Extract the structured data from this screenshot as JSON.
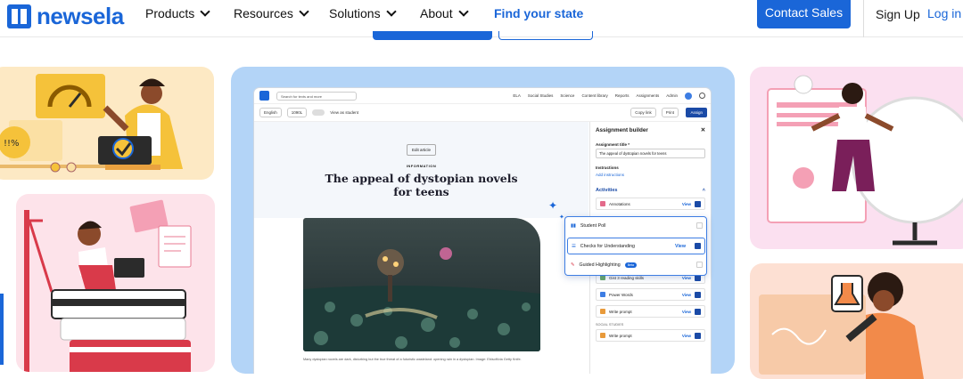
{
  "brand": {
    "name": "newsela"
  },
  "nav": {
    "items": [
      {
        "label": "Products",
        "has_menu": true
      },
      {
        "label": "Resources",
        "has_menu": true
      },
      {
        "label": "Solutions",
        "has_menu": true
      },
      {
        "label": "About",
        "has_menu": true
      }
    ],
    "find_state": "Find your state",
    "contact": "Contact Sales",
    "signup": "Sign Up",
    "login": "Log in"
  },
  "app": {
    "search_placeholder": "Search for texts and more",
    "top_links": [
      "ELA",
      "Social Studies",
      "Science",
      "Content library",
      "Reports",
      "Assignments",
      "Admin"
    ],
    "language": "English",
    "level": "1090L",
    "view_as_student": "View as student",
    "copy_link": "Copy link",
    "print": "Print",
    "assign": "Assign",
    "edit_article": "Edit article",
    "kicker": "INFORMATION",
    "article_title": "The appeal of dystopian novels for teens",
    "caption": "Many dystopian novels are dark, disturbing but the true threat of a futuristic wasteland: opening rain in a dystopian. Image: Ebisoft/via Getty Knife.",
    "builder": {
      "title": "Assignment builder",
      "title_label": "Assignment title *",
      "title_value": "The appeal of dystopian novels for teens",
      "instructions_label": "Instructions",
      "add_instructions": "Add instructions",
      "activities": "Activities",
      "rows": [
        {
          "label": "Annotations",
          "view": "View",
          "checked": true
        },
        {
          "label": "Gist 3 reading skills",
          "view": "View",
          "checked": true
        },
        {
          "label": "Power Words",
          "view": "View",
          "checked": true
        },
        {
          "label": "Write prompt",
          "view": "View",
          "checked": true
        }
      ],
      "section_social": "SOCIAL STUDIES",
      "social_row": {
        "label": "Write prompt",
        "view": "View",
        "checked": true
      }
    },
    "popout": {
      "student_poll": "Student Poll",
      "checks": "Checks for Understanding",
      "checks_view": "View",
      "guided": "Guided Highlighting",
      "beta": "Beta"
    }
  },
  "colors": {
    "brand_blue": "#1a66d8",
    "panel_blue": "#b3d4f7",
    "peach": "#fde9c4",
    "pink": "#fde3ea",
    "lavender": "#fbe0f0"
  }
}
